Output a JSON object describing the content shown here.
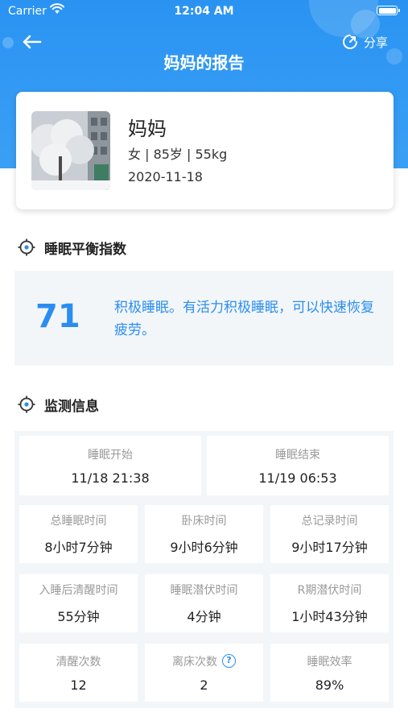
{
  "status_bar": {
    "carrier": "Carrier",
    "time": "12:04 AM"
  },
  "header": {
    "title": "妈妈的报告",
    "share_label": "分享"
  },
  "profile": {
    "name": "妈妈",
    "info": "女 | 85岁 | 55kg",
    "date": "2020-11-18"
  },
  "sleep_index": {
    "heading": "睡眠平衡指数",
    "score": "71",
    "description": "积极睡眠。有活力积极睡眠，可以快速恢复疲劳。"
  },
  "monitor": {
    "heading": "监测信息",
    "rows": [
      [
        {
          "label": "睡眠开始",
          "value": "11/18 21:38"
        },
        {
          "label": "睡眠结束",
          "value": "11/19 06:53"
        }
      ],
      [
        {
          "label": "总睡眠时间",
          "value": "8小时7分钟"
        },
        {
          "label": "卧床时间",
          "value": "9小时6分钟"
        },
        {
          "label": "总记录时间",
          "value": "9小时17分钟"
        }
      ],
      [
        {
          "label": "入睡后清醒时间",
          "value": "55分钟"
        },
        {
          "label": "睡眠潜伏时间",
          "value": "4分钟"
        },
        {
          "label": "R期潜伏时间",
          "value": "1小时43分钟"
        }
      ],
      [
        {
          "label": "清醒次数",
          "value": "12"
        },
        {
          "label": "离床次数",
          "value": "2",
          "help_icon": "?"
        },
        {
          "label": "睡眠效率",
          "value": "89%"
        }
      ]
    ]
  },
  "colors": {
    "primary": "#2a93f2",
    "accent_text": "#2a8ef0",
    "panel_bg": "#f3f6f9"
  }
}
